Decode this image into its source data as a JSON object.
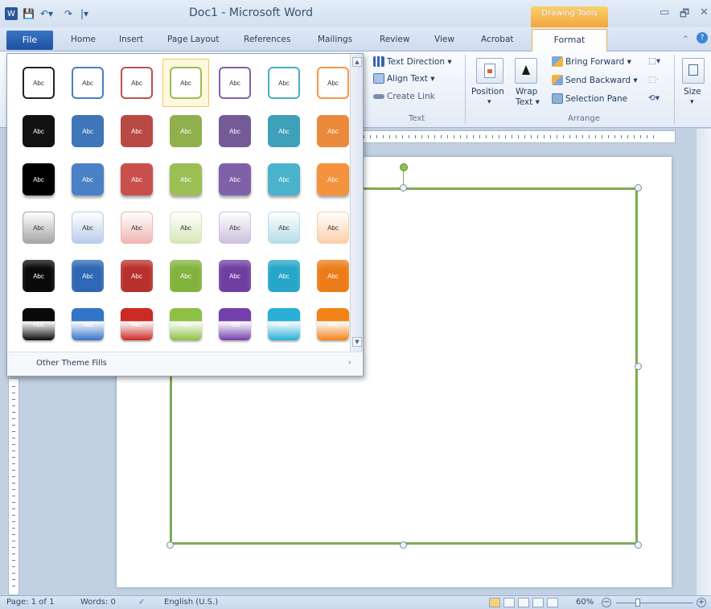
{
  "window": {
    "title": "Doc1 - Microsoft Word",
    "contextual_tab": "Drawing Tools",
    "qat": [
      "W",
      "💾",
      "↶▾",
      "↷",
      "|▾"
    ],
    "controls": [
      "▭",
      "🗗",
      "✕"
    ]
  },
  "tabs": {
    "file": "File",
    "items": [
      "Home",
      "Insert",
      "Page Layout",
      "References",
      "Mailings",
      "Review",
      "View",
      "Acrobat"
    ],
    "active": "Format"
  },
  "ribbon": {
    "text_group": {
      "label": "Text",
      "text_direction": "Text Direction ▾",
      "align_text": "Align Text ▾",
      "create_link": "Create Link"
    },
    "arrange_group": {
      "label": "Arrange",
      "position": "Position",
      "wrap_text_1": "Wrap",
      "wrap_text_2": "Text ▾",
      "bring_forward": "Bring Forward ▾",
      "send_backward": "Send Backward ▾",
      "selection_pane": "Selection Pane"
    },
    "size_group": {
      "label": "Size"
    }
  },
  "gallery": {
    "swatch_text": "Abc",
    "rows": [
      {
        "style": "outline",
        "colors": [
          "#222222",
          "#4a7fc1",
          "#c0504d",
          "#9bbb59",
          "#8064a2",
          "#4bacc6",
          "#f79646"
        ]
      },
      {
        "style": "solid",
        "colors": [
          "#111111",
          "#3f75b9",
          "#b94945",
          "#8fb04d",
          "#755a98",
          "#3fa0ba",
          "#ec893b"
        ]
      },
      {
        "style": "shadow",
        "colors": [
          "#000000",
          "#4a80c6",
          "#c94f4b",
          "#9bbf54",
          "#7f61a8",
          "#4bb2cc",
          "#f5923e"
        ]
      },
      {
        "style": "light",
        "colors": [
          "#a6a6a6",
          "#b9cde9",
          "#f0b5b4",
          "#d7e6b8",
          "#cdc0de",
          "#b5dde9",
          "#fbcfa9"
        ]
      },
      {
        "style": "intense",
        "colors": [
          "#0a0a0a",
          "#2e67b3",
          "#b7302b",
          "#82b33f",
          "#6e3fa0",
          "#26a6c8",
          "#ec7c17"
        ]
      },
      {
        "style": "gradient",
        "colors": [
          "#0a0a0a",
          "#3474c8",
          "#cc2a24",
          "#8dc044",
          "#7440ab",
          "#28b0d8",
          "#f38319"
        ]
      }
    ],
    "selected": {
      "row": 0,
      "col": 3
    },
    "footer_label": "Other Theme Fills",
    "footer_arrow": "›"
  },
  "status": {
    "page": "Page: 1 of 1",
    "words": "Words: 0",
    "language": "English (U.S.)",
    "zoom": "60%"
  }
}
